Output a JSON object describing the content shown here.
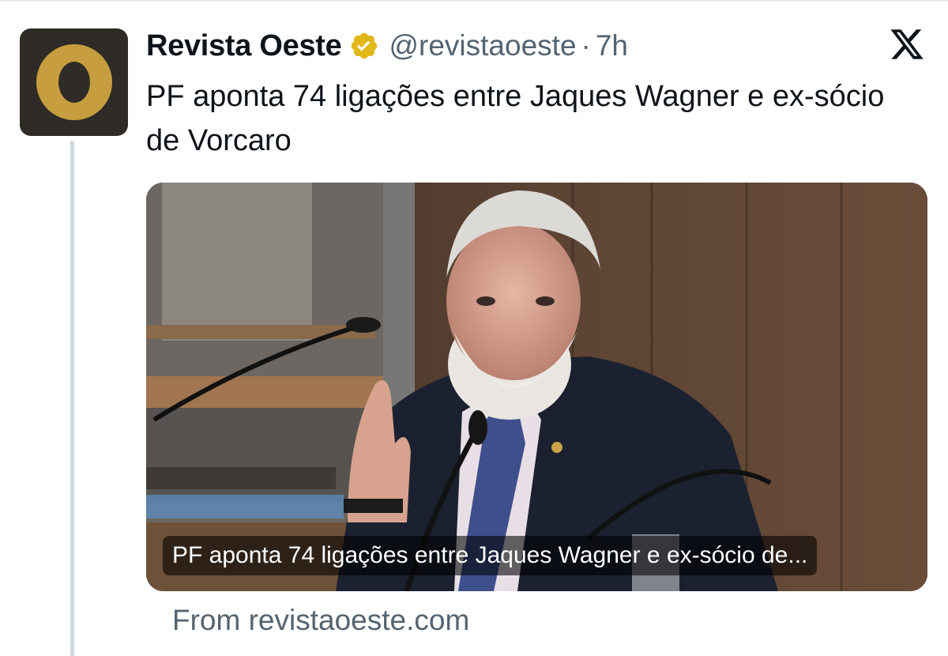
{
  "account": {
    "name": "Revista Oeste",
    "handle": "@revistaoeste",
    "separator": "·",
    "time": "7h",
    "verified_badge": "gold-verified-badge-icon",
    "avatar_icon": "revista-oeste-logo-icon"
  },
  "tweet": {
    "text": "PF aponta 74 ligações entre Jaques Wagner e ex-sócio de Vorcaro"
  },
  "card": {
    "caption": "PF aponta 74 ligações entre Jaques Wagner e ex-sócio de...",
    "image_icon": "news-photo"
  },
  "source": {
    "text": "From revistaoeste.com"
  },
  "colors": {
    "text_primary": "#0f1419",
    "text_secondary": "#536471",
    "verified_gold": "#e2b719",
    "logo_gold": "#c79e3f",
    "logo_bg": "#2f2b27",
    "thread_line": "#cfd9de"
  },
  "icons": {
    "platform": "x-logo-icon"
  }
}
